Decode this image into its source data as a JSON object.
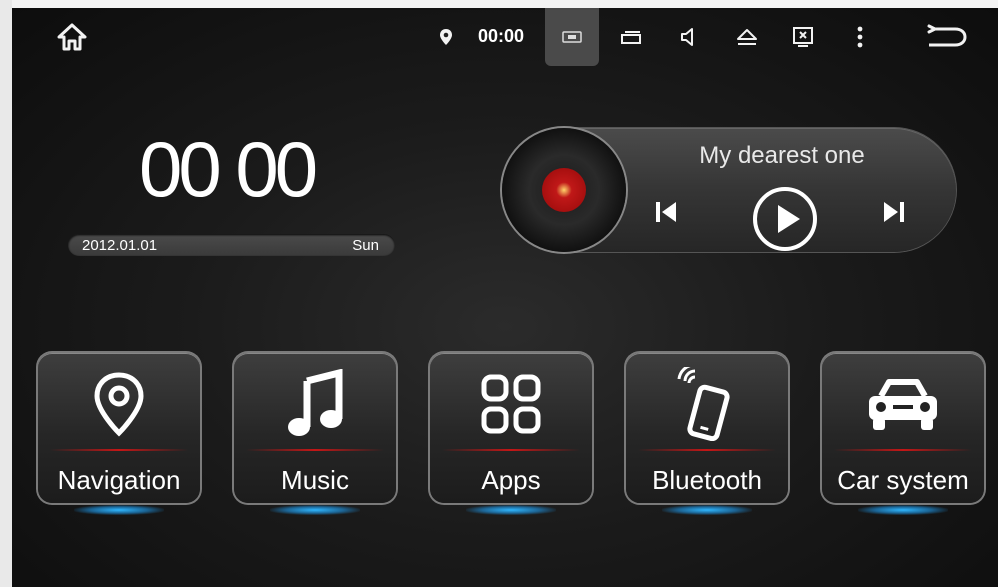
{
  "status_bar": {
    "time": "00:00",
    "icons": [
      "home-icon",
      "location-pin-icon",
      "screen-mirror-icon",
      "window-switch-icon",
      "volume-icon",
      "eject-icon",
      "close-screen-icon",
      "more-vertical-icon",
      "back-icon"
    ]
  },
  "clock": {
    "time": "00 00",
    "date": "2012.01.01",
    "day": "Sun"
  },
  "music": {
    "title": "My dearest one"
  },
  "apps": [
    {
      "label": "Navigation",
      "icon": "location-pin-icon"
    },
    {
      "label": "Music",
      "icon": "music-note-icon"
    },
    {
      "label": "Apps",
      "icon": "apps-grid-icon"
    },
    {
      "label": "Bluetooth",
      "icon": "phone-signal-icon"
    },
    {
      "label": "Car system",
      "icon": "car-icon"
    }
  ],
  "colors": {
    "accent_red": "#c41616",
    "glow_blue": "#2fb7ff"
  }
}
